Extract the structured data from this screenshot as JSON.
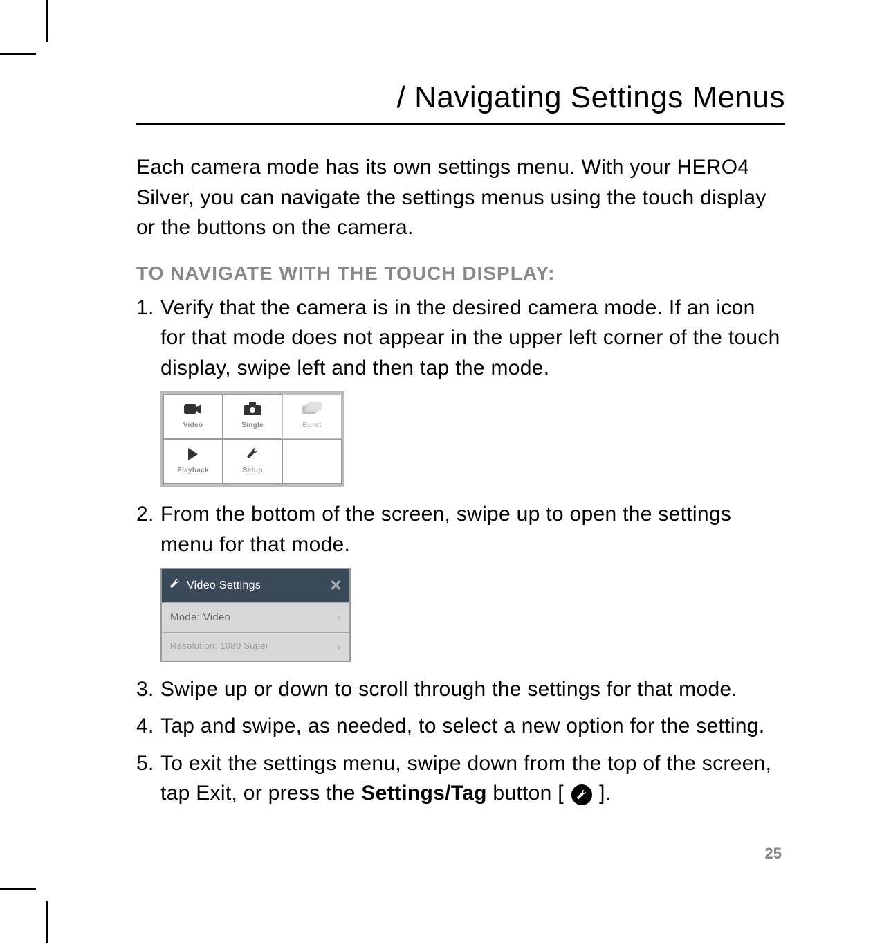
{
  "page": {
    "title": "/ Navigating Settings Menus",
    "intro": "Each camera mode has its own settings menu. With your HERO4 Silver, you can navigate the settings menus using the touch display or the buttons on the camera.",
    "section_heading": "TO NAVIGATE WITH THE TOUCH DISPLAY:",
    "page_number": "25"
  },
  "steps": {
    "s1_num": "1.",
    "s1": "Verify that the camera is in the desired camera mode. If an icon for that mode does not appear in the upper left corner of the touch display, swipe left and then tap the mode.",
    "s2_num": "2.",
    "s2": "From the bottom of the screen, swipe up to open the settings menu for that mode.",
    "s3_num": "3.",
    "s3": "Swipe up or down to scroll through the settings for that mode.",
    "s4_num": "4.",
    "s4": "Tap and swipe, as needed, to select a new option for the setting.",
    "s5_num": "5.",
    "s5_a": "To exit the settings menu, swipe down from the top of the screen, tap Exit, or press the ",
    "s5_b": "Settings/Tag",
    "s5_c": " button [ ",
    "s5_d": " ]."
  },
  "mode_grid": {
    "video": "Video",
    "single": "Single",
    "burst": "Burst",
    "playback": "Playback",
    "setup": "Setup"
  },
  "settings_panel": {
    "title": "Video Settings",
    "row1": "Mode: Video",
    "row2": "Resolution: 1080 Super"
  }
}
